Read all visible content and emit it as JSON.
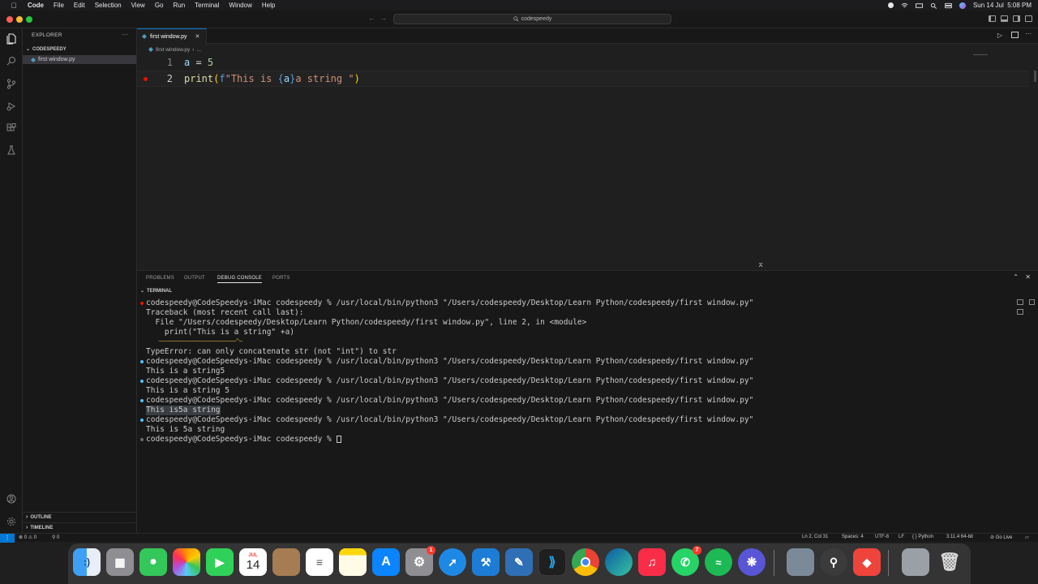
{
  "menubar": {
    "app_name": "Code",
    "items": [
      "File",
      "Edit",
      "Selection",
      "View",
      "Go",
      "Run",
      "Terminal",
      "Window",
      "Help"
    ],
    "datetime": "Sun 14 Jul  5:08 PM"
  },
  "titlebar": {
    "search_text": "codespeedy"
  },
  "sidebar": {
    "header": "EXPLORER",
    "folder": "CODESPEEDY",
    "file": "first window.py",
    "sections": [
      "OUTLINE",
      "TIMELINE"
    ]
  },
  "editor": {
    "tab_label": "first window.py",
    "breadcrumb_file": "first window.py",
    "breadcrumb_more": "...",
    "line_numbers": [
      "1",
      "2"
    ],
    "line1": {
      "var": "a",
      "op": " = ",
      "num": "5"
    },
    "line2": {
      "fn": "print",
      "open": "(",
      "prefix": "f",
      "s1": "\"This is ",
      "lb": "{",
      "var": "a",
      "rb": "}",
      "s2": "a string \"",
      "close": ")"
    }
  },
  "panel": {
    "tabs": [
      "PROBLEMS",
      "OUTPUT",
      "DEBUG CONSOLE",
      "PORTS"
    ],
    "active_tab": "DEBUG CONSOLE",
    "terminal_header": "TERMINAL",
    "lines": [
      "codespeedy@CodeSpeedys-iMac codespeedy % /usr/local/bin/python3 \"/Users/codespeedy/Desktop/Learn Python/codespeedy/first window.py\"",
      "Traceback (most recent call last):",
      "  File \"/Users/codespeedy/Desktop/Learn Python/codespeedy/first window.py\", line 2, in <module>",
      "    print(\"This is a string\" +a)",
      "    ~~~~~~~~~~~~~~~~~~~~~~~~~^~",
      "TypeError: can only concatenate str (not \"int\") to str",
      "codespeedy@CodeSpeedys-iMac codespeedy % /usr/local/bin/python3 \"/Users/codespeedy/Desktop/Learn Python/codespeedy/first window.py\"",
      "This is a string5",
      "codespeedy@CodeSpeedys-iMac codespeedy % /usr/local/bin/python3 \"/Users/codespeedy/Desktop/Learn Python/codespeedy/first window.py\"",
      "This is a string 5",
      "codespeedy@CodeSpeedys-iMac codespeedy % /usr/local/bin/python3 \"/Users/codespeedy/Desktop/Learn Python/codespeedy/first window.py\"",
      "This is5a string",
      "codespeedy@CodeSpeedys-iMac codespeedy % /usr/local/bin/python3 \"/Users/codespeedy/Desktop/Learn Python/codespeedy/first window.py\"",
      "This is 5a string",
      "codespeedy@CodeSpeedys-iMac codespeedy % "
    ]
  },
  "statusbar": {
    "problems": "⊗ 0 ⚠ 0",
    "ports": "⚲ 0",
    "position": "Ln 2, Col 31",
    "spaces": "Spaces: 4",
    "encoding": "UTF-8",
    "eol": "LF",
    "language": "{ } Python",
    "interpreter": "3.11.4 64-bit",
    "golive": "⊘ Go Live"
  },
  "dock": {
    "calendar_month": "JUL",
    "calendar_day": "14",
    "appstore_badge": "1",
    "whatsapp_badge": "7"
  },
  "colors": {
    "accent": "#0078d4",
    "breakpoint": "#e51400",
    "prompt_dot_error": "#e51400",
    "prompt_dot_ok": "#4fc1ff"
  }
}
